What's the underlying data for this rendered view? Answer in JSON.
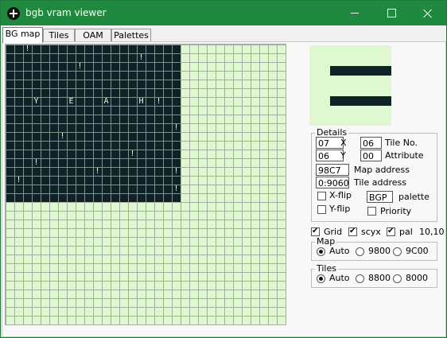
{
  "window": {
    "title": "bgb vram viewer"
  },
  "tabs": [
    "BG map",
    "Tiles",
    "OAM",
    "Palettes"
  ],
  "map_preview": {
    "marks": [
      "!",
      "!",
      "!",
      "Y",
      "E",
      "A",
      "H",
      "!",
      "!",
      "!",
      "!",
      "!",
      "!",
      "!",
      "!",
      "!"
    ]
  },
  "details": {
    "title": "Details",
    "x_value": "07",
    "x_label": "X",
    "y_value": "06",
    "y_label": "Y",
    "tile_no_value": "06",
    "tile_no_label": "Tile No.",
    "attribute_value": "00",
    "attribute_label": "Attribute",
    "map_address_value": "98C7",
    "map_address_label": "Map address",
    "tile_address_value": "0:9060",
    "tile_address_label": "Tile address",
    "xflip_label": "X-flip",
    "yflip_label": "Y-flip",
    "palette_value": "BGP",
    "palette_label": "palette",
    "priority_label": "Priority"
  },
  "options": {
    "grid_label": "Grid",
    "scyx_label": "scyx",
    "pal_label": "pal",
    "coordinates": "10,10"
  },
  "map_group": {
    "title": "Map",
    "auto_label": "Auto",
    "option_9800": "9800",
    "option_9c00": "9C00"
  },
  "tiles_group": {
    "title": "Tiles",
    "auto_label": "Auto",
    "option_8800": "8800",
    "option_8000": "8000"
  }
}
